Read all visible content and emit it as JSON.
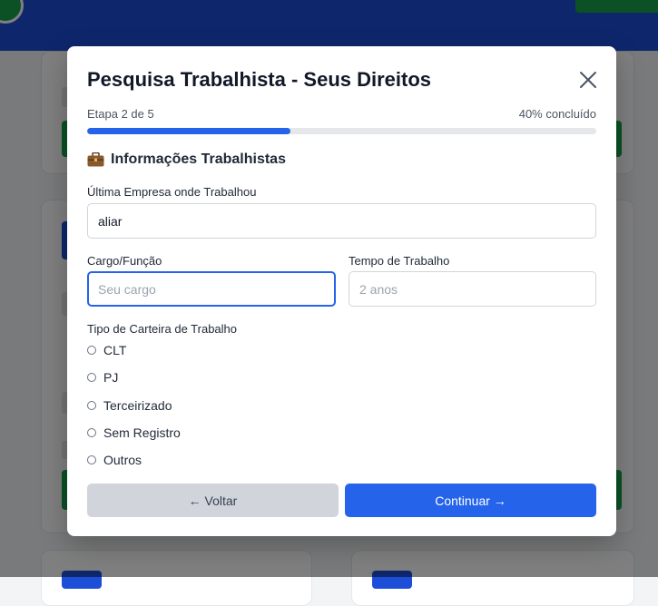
{
  "modal": {
    "title": "Pesquisa Trabalhista - Seus Direitos",
    "step_label": "Etapa 2 de 5",
    "progress_label": "40% concluído",
    "progress_fraction": 0.4,
    "section_icon": "briefcase-icon",
    "section_title": "Informações Trabalhistas",
    "fields": {
      "company": {
        "label": "Última Empresa onde Trabalhou",
        "value": "aliar"
      },
      "role": {
        "label": "Cargo/Função",
        "value": "",
        "placeholder": "Seu cargo"
      },
      "duration": {
        "label": "Tempo de Trabalho",
        "value": "",
        "placeholder": "2 anos"
      }
    },
    "contract_type": {
      "label": "Tipo de Carteira de Trabalho",
      "options": [
        "CLT",
        "PJ",
        "Terceirizado",
        "Sem Registro",
        "Outros"
      ]
    },
    "buttons": {
      "back": "← Voltar",
      "next": "Continuar →"
    },
    "colors": {
      "primary": "#2563eb",
      "header": "#1d4ed8",
      "accent_green": "#16a34a"
    }
  }
}
